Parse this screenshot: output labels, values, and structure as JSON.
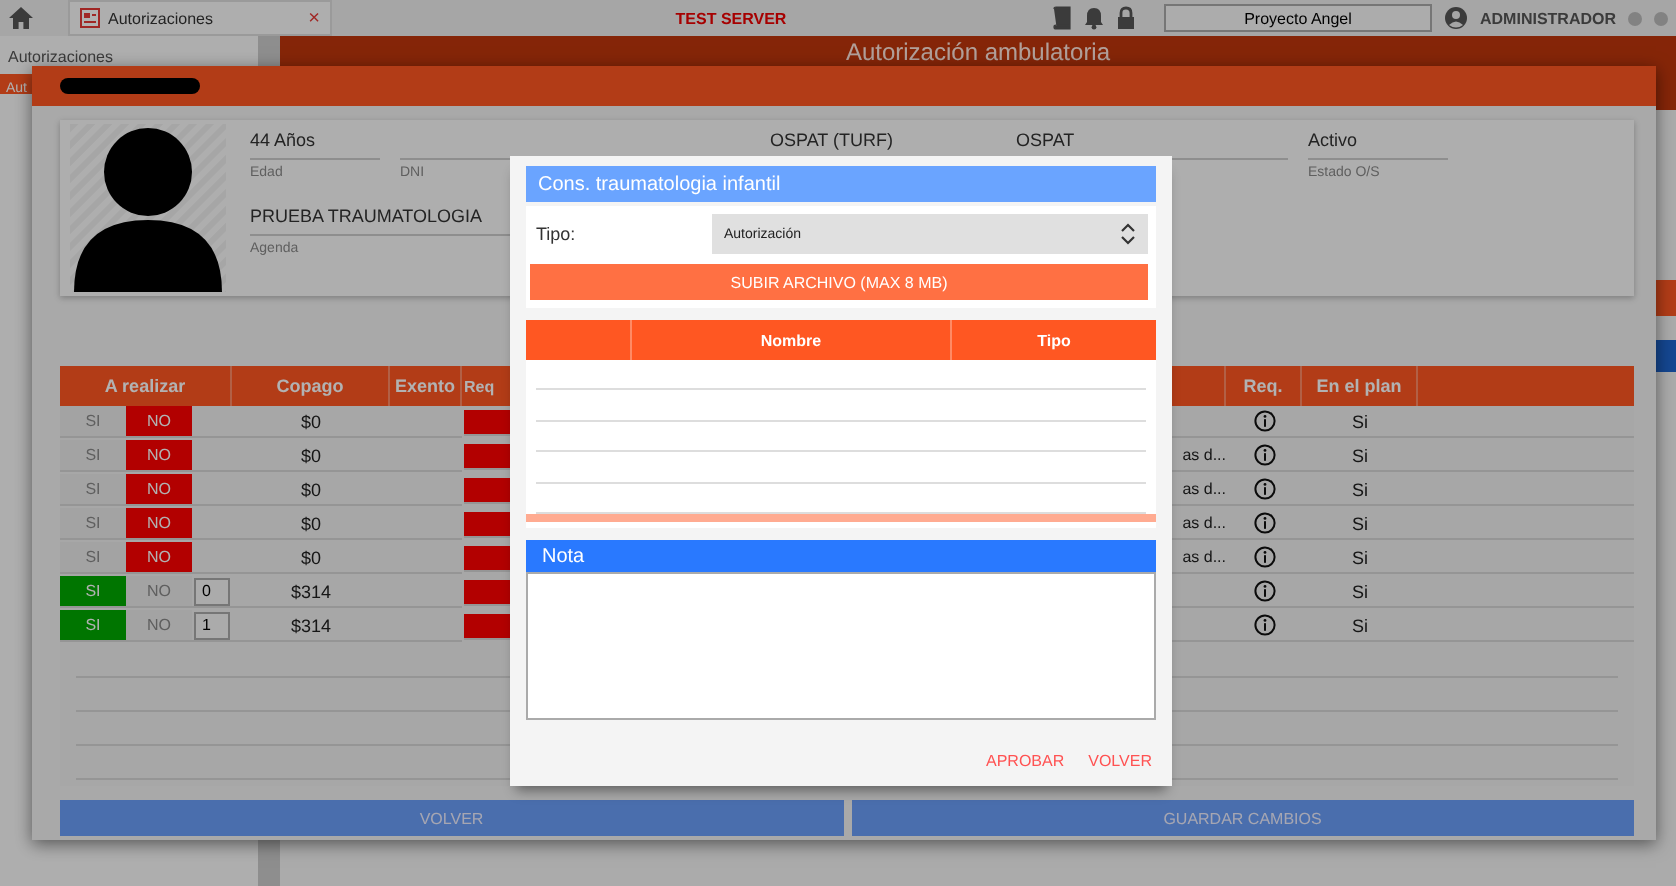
{
  "topbar": {
    "tab": {
      "label": "Autorizaciones",
      "selected": true
    },
    "close": "×",
    "server_label": "TEST SERVER",
    "project_field": {
      "value": "Proyecto Angel"
    },
    "user": "ADMINISTRADOR"
  },
  "sidebar": {
    "title": "Autorizaciones",
    "items": [
      {
        "label": "Aut",
        "selected": true
      }
    ]
  },
  "page_header": {
    "title": "Autorización ambulatoria"
  },
  "patient_dialog": {
    "fields": [
      {
        "kind": "text",
        "value": "44 Años",
        "label": "Edad"
      },
      {
        "kind": "redacted",
        "label": "DNI"
      },
      {
        "kind": "redacted"
      },
      {
        "kind": "text",
        "value": "OSPAT (TURF)"
      },
      {
        "kind": "text",
        "value": "OSPAT"
      },
      {
        "kind": "text",
        "value": "Activo",
        "label": "Estado O/S"
      }
    ],
    "agenda": {
      "kind": "text",
      "value": "PRUEBA TRAUMATOLOGIA",
      "label": "Agenda"
    },
    "table": {
      "columns": [
        "A realizar",
        "Copago",
        "Exento",
        "Req",
        "Req.",
        "En el plan"
      ],
      "rows": [
        {
          "choice": [
            {
              "label": "SI",
              "selected": false
            },
            {
              "label": "NO",
              "selected": true
            }
          ],
          "copago": "$0",
          "plan": "Si"
        },
        {
          "choice": [
            {
              "label": "SI",
              "selected": false
            },
            {
              "label": "NO",
              "selected": true
            }
          ],
          "copago": "$0",
          "column_7": "as d...",
          "plan": "Si"
        },
        {
          "choice": [
            {
              "label": "SI",
              "selected": false
            },
            {
              "label": "NO",
              "selected": true
            }
          ],
          "copago": "$0",
          "column_7": "as d...",
          "plan": "Si"
        },
        {
          "choice": [
            {
              "label": "SI",
              "selected": false
            },
            {
              "label": "NO",
              "selected": true
            }
          ],
          "copago": "$0",
          "column_7": "as d...",
          "plan": "Si"
        },
        {
          "choice": [
            {
              "label": "SI",
              "selected": false
            },
            {
              "label": "NO",
              "selected": true
            }
          ],
          "copago": "$0",
          "column_7": "as d...",
          "plan": "Si"
        },
        {
          "choice": [
            {
              "label": "SI",
              "selected": true
            },
            {
              "label": "NO",
              "selected": false
            }
          ],
          "quantity": "0",
          "copago": "$314",
          "plan": "Si"
        },
        {
          "choice": [
            {
              "label": "SI",
              "selected": true
            },
            {
              "label": "NO",
              "selected": false
            }
          ],
          "quantity": "1",
          "copago": "$314",
          "plan": "Si"
        }
      ]
    },
    "buttons": [
      "VOLVER",
      "GUARDAR CAMBIOS"
    ]
  },
  "modal": {
    "title": "Cons. traumatologia infantil",
    "tipo_label": "Tipo:",
    "tipo_select": {
      "value": "Autorización"
    },
    "upload_button": "SUBIR ARCHIVO (MAX 8 MB)",
    "files_table": {
      "columns": [
        "Nombre",
        "Tipo"
      ]
    },
    "nota_label": "Nota",
    "actions": [
      "APROBAR",
      "VOLVER"
    ]
  }
}
